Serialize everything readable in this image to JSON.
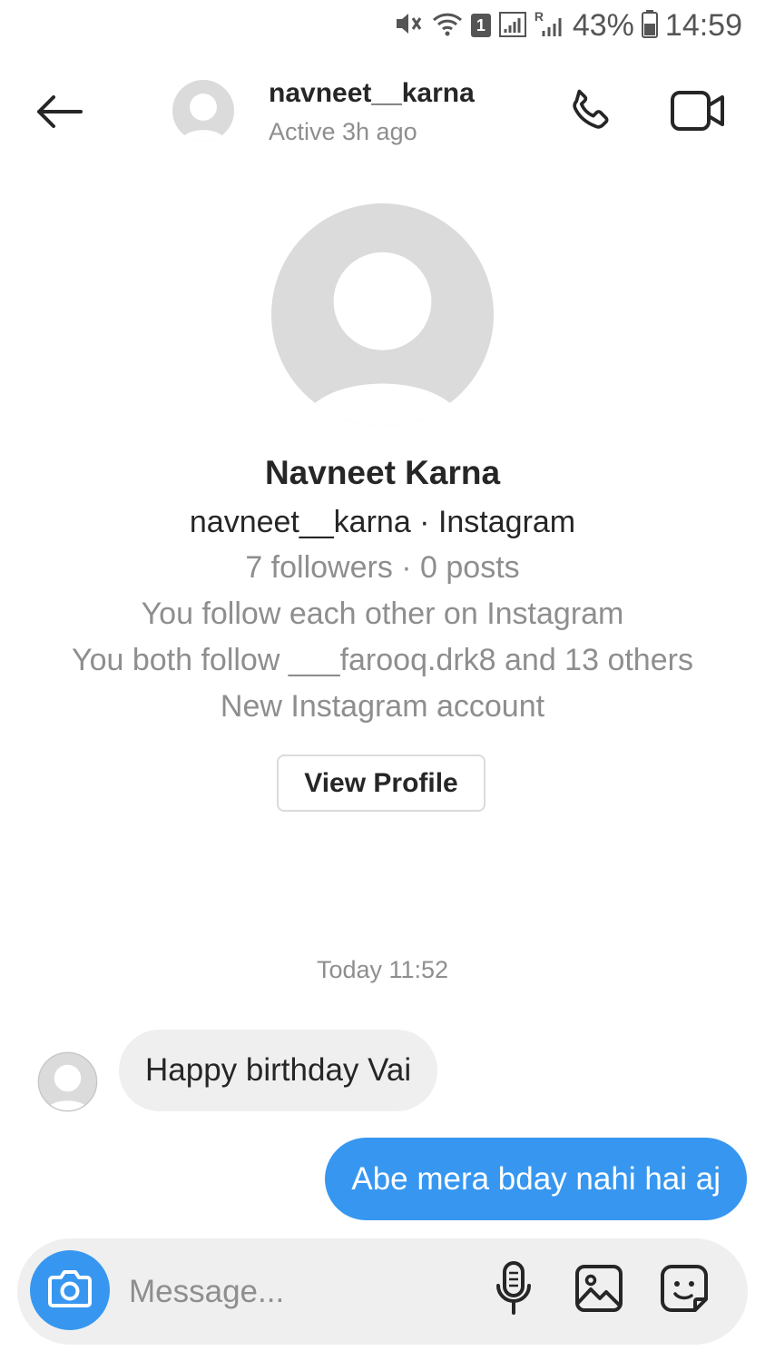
{
  "status_bar": {
    "sim_badge": "1",
    "roaming_label": "R",
    "battery": "43%",
    "time": "14:59"
  },
  "header": {
    "username": "navneet__karna",
    "active_status": "Active 3h ago",
    "icons": [
      "back-arrow-icon",
      "phone-icon",
      "video-camera-icon"
    ]
  },
  "profile": {
    "name": "Navneet Karna",
    "handle_line": "navneet__karna · Instagram",
    "stats": "7 followers · 0 posts",
    "mutual_follow": "You follow each other on Instagram",
    "mutual_friends": "You both follow ___farooq.drk8 and 13 others",
    "account_note": "New Instagram account",
    "view_profile_label": "View Profile"
  },
  "conversation": {
    "timestamp": "Today 11:52",
    "messages": [
      {
        "direction": "received",
        "text": "Happy birthday Vai"
      },
      {
        "direction": "sent",
        "text": "Abe mera bday nahi hai aj"
      }
    ]
  },
  "composer": {
    "placeholder": "Message...",
    "icons": [
      "camera-icon",
      "microphone-icon",
      "gallery-icon",
      "sticker-icon"
    ]
  },
  "colors": {
    "accent_blue": "#3797f0",
    "received_bubble": "#efefef",
    "secondary_text": "#8e8e8e",
    "avatar_grey": "#dbdbdb"
  }
}
